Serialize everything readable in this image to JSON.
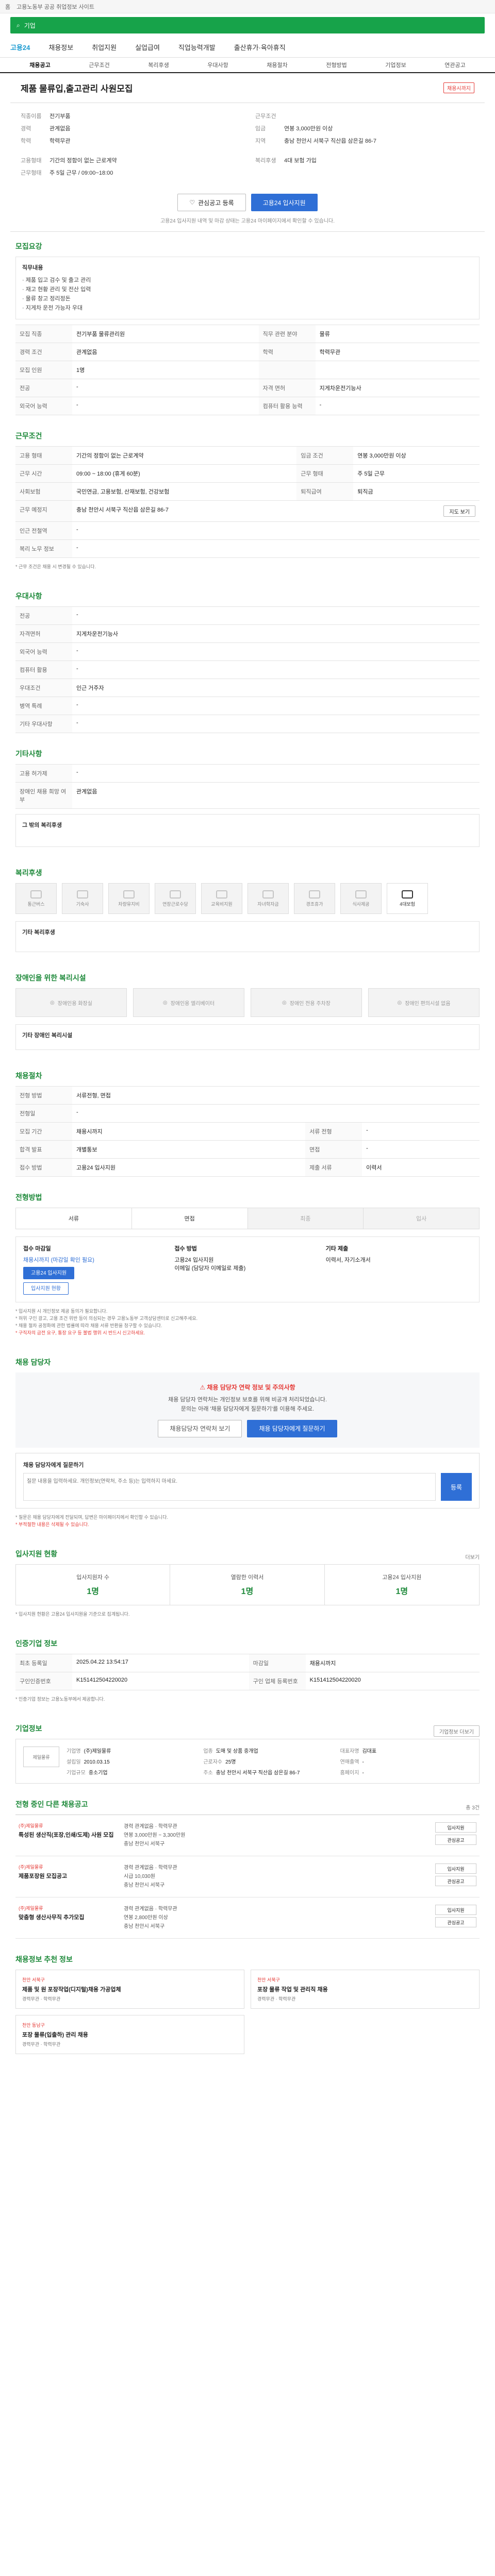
{
  "topbar": {
    "home": "홈",
    "notice": "고용노동부 공공 취업정보 사이트"
  },
  "search": {
    "placeholder": "기업",
    "button": "검색"
  },
  "nav": {
    "logo": "고용24",
    "items": [
      "채용정보",
      "취업지원",
      "실업급여",
      "직업능력개발",
      "출산휴가·육아휴직"
    ]
  },
  "subnav": {
    "tabs": [
      "채용공고",
      "근무조건",
      "복리후생",
      "우대사항",
      "채용절차",
      "전형방법",
      "기업정보",
      "연관공고"
    ],
    "active": 0
  },
  "job": {
    "title": "제품 물류입,출고관리 사원모집",
    "badge": "채용시까지",
    "left": [
      {
        "k": "직종이름",
        "v": "전기부품"
      },
      {
        "k": "경력",
        "v": "관계없음"
      },
      {
        "k": "학력",
        "v": "학력무관"
      }
    ],
    "right": [
      {
        "k": "근무조건",
        "v": ""
      },
      {
        "k": "임금",
        "v": "연봉 3,000만원 이상"
      },
      {
        "k": "지역",
        "v": "충남 천안시 서북구 직산읍 삼은길 86-7"
      }
    ],
    "left2": [
      {
        "k": "고용형태",
        "v": "기간의 정함이 없는 근로계약"
      },
      {
        "k": "근무형태",
        "v": "주 5일 근무 / 09:00~18:00"
      }
    ],
    "right2": [
      {
        "k": "복리후생",
        "v": "4대 보험 가입"
      }
    ],
    "scrap": "관심공고 등록",
    "apply": "고용24 입사지원",
    "notice": "고용24 입사지원 내역 및 마감 상태는 고용24 마이페이지에서 확인할 수 있습니다."
  },
  "recruit": {
    "title": "모집요강",
    "duty_label": "직무내용",
    "duties": [
      "· 제품 입고 검수 및 출고 관리",
      "· 재고 현황 관리 및 전산 입력",
      "· 물류 창고 정리정돈",
      "· 지게차 운전 가능자 우대"
    ],
    "rows": [
      {
        "k": "모집 직종",
        "v": "전기부품 물류관리원",
        "k2": "직무 관련 분야",
        "v2": "물류"
      },
      {
        "k": "경력 조건",
        "v": "관계없음",
        "k2": "학력",
        "v2": "학력무관"
      },
      {
        "k": "모집 인원",
        "v": "1명",
        "k2": "",
        "v2": ""
      },
      {
        "k": "전공",
        "v": "-",
        "k2": "자격 면허",
        "v2": "지게차운전기능사"
      },
      {
        "k": "외국어 능력",
        "v": "-",
        "k2": "컴퓨터 활용 능력",
        "v2": "-"
      }
    ]
  },
  "cond": {
    "title": "근무조건",
    "rows": [
      {
        "k": "고용 형태",
        "v": "기간의 정함이 없는 근로계약",
        "k2": "임금 조건",
        "v2": "연봉 3,000만원 이상"
      },
      {
        "k": "근무 시간",
        "v": "09:00 ~ 18:00 (휴게 60분)",
        "k2": "근무 형태",
        "v2": "주 5일 근무"
      },
      {
        "k": "사회보험",
        "v": "국민연금, 고용보험, 산재보험, 건강보험",
        "k2": "퇴직급여",
        "v2": "퇴직금"
      },
      {
        "k": "근무 예정지",
        "v": "충남 천안시 서북구 직산읍 삼은길 86-7",
        "k2": "",
        "v2": ""
      },
      {
        "k": "인근 전철역",
        "v": "-",
        "k2": "",
        "v2": ""
      },
      {
        "k": "복리 노무 정보",
        "v": "-",
        "k2": "",
        "v2": ""
      }
    ],
    "map_link": "지도 보기",
    "footnote": "* 근무 조건은 채용 시 변경될 수 있습니다."
  },
  "pref": {
    "title": "우대사항",
    "rows": [
      {
        "k": "전공",
        "v": "-"
      },
      {
        "k": "자격면허",
        "v": "지게차운전기능사"
      },
      {
        "k": "외국어 능력",
        "v": "-"
      },
      {
        "k": "컴퓨터 활용",
        "v": "-"
      },
      {
        "k": "우대조건",
        "v": "인근 거주자"
      },
      {
        "k": "병역 특례",
        "v": "-"
      },
      {
        "k": "기타 우대사항",
        "v": "-"
      }
    ]
  },
  "etc": {
    "title": "기타사항",
    "rows": [
      {
        "k": "고용 허가제",
        "v": "-"
      },
      {
        "k": "장애인 채용 희망 여부",
        "v": "관계없음"
      }
    ],
    "desc_title": "그 밖의 복리후생"
  },
  "welfare": {
    "title": "복리후생",
    "cards": [
      "통근버스",
      "기숙사",
      "차량유지비",
      "연장근로수당",
      "교육비지원",
      "자녀학자금",
      "경조휴가",
      "식사제공",
      "4대보험"
    ],
    "on": [
      8
    ],
    "extra_title": "기타 복리후생"
  },
  "disab": {
    "title": "장애인을 위한 복리시설",
    "cards": [
      "장애인용 화장실",
      "장애인용 엘리베이터",
      "장애인 전용 주차장",
      "장애인 편의시설 없음"
    ],
    "extra_title": "기타 장애인 복리시설"
  },
  "process": {
    "title": "채용절차",
    "rows": [
      {
        "k": "전형 방법",
        "v": "서류전형, 면접"
      },
      {
        "k": "전형일",
        "v": "-"
      },
      {
        "k": "모집 기간",
        "v": "채용시까지",
        "k2": "서류 전형",
        "v2": "-"
      },
      {
        "k": "합격 발표",
        "v": "개별통보",
        "k2": "면접",
        "v2": "-"
      },
      {
        "k": "접수 방법",
        "v": "고용24 입사지원",
        "k2": "제출 서류",
        "v2": "이력서"
      }
    ]
  },
  "steps": {
    "title": "전형방법",
    "items": [
      "서류",
      "면접",
      "최종",
      "입사"
    ],
    "on": [
      0,
      1
    ]
  },
  "apply": {
    "col1_title": "접수 마감일",
    "col1_val": "채용시까지 (마감일 확인 필요)",
    "col2_title": "접수 방법",
    "col2_vals": [
      "고용24 입사지원",
      "이메일 (담당자 이메일로 제출)"
    ],
    "col3_title": "기타 제출",
    "col3_val": "이력서, 자기소개서",
    "btn1": "고용24 입사지원",
    "btn2": "입사지원 현황",
    "notes": [
      "* 입사지원 시 개인정보 제공 동의가 필요합니다.",
      "* 허위 구인 광고, 고용 조건 위반 등이 의심되는 경우 고용노동부 고객상담센터로 신고해주세요.",
      "* 채용 절차 공정화에 관한 법률에 따라 채용 서류 반환을 청구할 수 있습니다."
    ],
    "notes_red": "* 구직자의 금전 요구, 통장 요구 등 불법 행위 시 반드시 신고하세요."
  },
  "safe": {
    "section": "채용 담당자",
    "title": "채용 담당자 연락 정보 및 주의사항",
    "lines": [
      "채용 담당자 연락처는 개인정보 보호를 위해 비공개 처리되었습니다.",
      "문의는 아래 '채용 담당자에게 질문하기'를 이용해 주세요."
    ],
    "btn1": "채용담당자 연락처 보기",
    "btn2": "채용 담당자에게 질문하기",
    "q_title": "채용 담당자에게 질문하기",
    "q_placeholder": "질문 내용을 입력하세요. 개인정보(연락처, 주소 등)는 입력하지 마세요.",
    "q_btn": "등록",
    "q_notes": [
      "* 질문은 채용 담당자에게 전달되며, 답변은 마이페이지에서 확인할 수 있습니다.",
      "* 부적절한 내용은 삭제될 수 있습니다."
    ]
  },
  "stats": {
    "title": "입사지원 현황",
    "more": "더보기",
    "items": [
      {
        "k": "입사지원자 수",
        "v": "1명"
      },
      {
        "k": "열람한 이력서",
        "v": "1명"
      },
      {
        "k": "고용24 입사지원",
        "v": "1명"
      }
    ],
    "note": "* 입사지원 현황은 고용24 입사지원을 기준으로 집계됩니다."
  },
  "info": {
    "title": "인증기업 정보",
    "rows": [
      {
        "k": "최초 등록일",
        "v": "2025.04.22 13:54:17",
        "k2": "마감일",
        "v2": "채용시까지"
      },
      {
        "k": "구인인증번호",
        "v": "K151412504220020",
        "k2": "구인 업체 등록번호",
        "v2": "K151412504220020"
      }
    ],
    "notes": [
      "* 인증기업 정보는 고용노동부에서 제공합니다."
    ]
  },
  "company": {
    "title": "기업정보",
    "more": "기업정보 더보기",
    "logo": "제일물류",
    "rows": [
      {
        "k": "기업명",
        "v": "(주)제일물류"
      },
      {
        "k": "업종",
        "v": "도매 및 상품 중개업"
      },
      {
        "k": "대표자명",
        "v": "김대표"
      },
      {
        "k": "설립일",
        "v": "2010.03.15"
      },
      {
        "k": "근로자수",
        "v": "25명"
      },
      {
        "k": "연매출액",
        "v": "-"
      },
      {
        "k": "기업규모",
        "v": "중소기업"
      },
      {
        "k": "주소",
        "v": "충남 천안시 서북구 직산읍 삼은길 86-7"
      },
      {
        "k": "홈페이지",
        "v": "-"
      }
    ]
  },
  "related": {
    "title": "전형 중인 다른 채용공고",
    "sub": "총 3건",
    "items": [
      {
        "co": "(주)제일물류",
        "t": "특성된 생산직(포장,인쇄/도제) 사원 모집",
        "m": [
          "경력 관계없음 · 학력무관",
          "연봉 3,000만원 ~ 3,300만원",
          "충남 천안시 서북구"
        ],
        "b": [
          "입사지원",
          "관심공고"
        ]
      },
      {
        "co": "(주)제일물류",
        "t": "제품포장원 모집공고",
        "m": [
          "경력 관계없음 · 학력무관",
          "시급 10,030원",
          "충남 천안시 서북구"
        ],
        "b": [
          "입사지원",
          "관심공고"
        ]
      },
      {
        "co": "(주)제일물류",
        "t": "맞춤형 생산사무직 추가모집",
        "m": [
          "경력 관계없음 · 학력무관",
          "연봉 2,800만원 이상",
          "충남 천안시 서북구"
        ],
        "b": [
          "입사지원",
          "관심공고"
        ]
      }
    ]
  },
  "rec": {
    "title": "채용정보 추천 정보",
    "items": [
      {
        "co": "천안 서북구",
        "t": "제품 및 원 포장작업(디지털)채용 가공업체",
        "m": "경력무관 · 학력무관"
      },
      {
        "co": "천안 서북구",
        "t": "포장 물류 작업 및 관리직 채용",
        "m": "경력무관 · 학력무관"
      },
      {
        "co": "천안 동남구",
        "t": "포장 물류(입출하) 관리 채용",
        "m": "경력무관 · 학력무관"
      }
    ]
  }
}
